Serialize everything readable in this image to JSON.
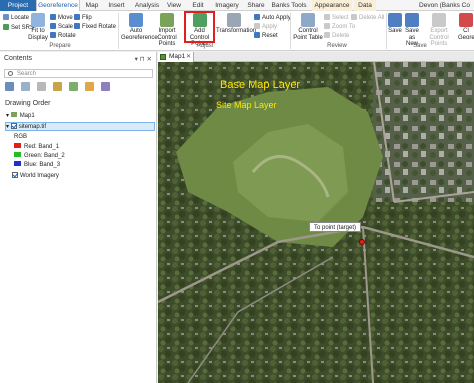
{
  "tabs": [
    "Project",
    "Georeference",
    "Map",
    "Insert",
    "Analysis",
    "View",
    "Edit",
    "Imagery",
    "Share",
    "Banks Tools",
    "Appearance",
    "Data"
  ],
  "user": "Devon (Banks Co",
  "ribbon": {
    "prepare": {
      "locate": "Locate",
      "set_srs": "Set SRS",
      "fit_to_display": "Fit to Display",
      "move": "Move",
      "scale": "Scale",
      "rotate": "Rotate",
      "flip": "Flip",
      "fixed_rotate": "Fixed Rotate",
      "group": "Prepare"
    },
    "adjust": {
      "auto_georeference": "Auto Georeference",
      "import_control_points": "Import Control Points",
      "add_control_points": "Add Control Points",
      "transformation": "Transformation",
      "auto_apply": "Auto Apply",
      "apply": "Apply",
      "reset": "Reset",
      "group": "Adjust"
    },
    "review": {
      "control_point_table": "Control Point Table",
      "select": "Select",
      "zoom_to": "Zoom To",
      "delete": "Delete",
      "delete_all": "Delete All",
      "group": "Review"
    },
    "save": {
      "save": "Save",
      "save_as_new": "Save as New",
      "export_control_points": "Export Control Points",
      "close": "Cl Geore",
      "group": "Save"
    }
  },
  "contents": {
    "title": "Contents",
    "search_placeholder": "Search",
    "drawing_order": "Drawing Order",
    "map_name": "Map1",
    "layer_sitemap": "sitemap.tif",
    "rgb": "RGB",
    "bands": [
      {
        "label": "Red:  Band_1",
        "color": "#e0201c"
      },
      {
        "label": "Green: Band_2",
        "color": "#22c022"
      },
      {
        "label": "Blue:  Band_3",
        "color": "#1c2fd0"
      }
    ],
    "world_imagery": "World Imagery"
  },
  "map": {
    "tab_label": "Map1",
    "base_map_label": "Base Map Layer",
    "site_map_label": "Site Map Layer",
    "target_tooltip": "To point (target)"
  },
  "colors": {
    "accent": "#1e5fa8",
    "project_tab": "#2b6cb0",
    "highlight": "#e0201c",
    "annotation": "#ffe600"
  }
}
